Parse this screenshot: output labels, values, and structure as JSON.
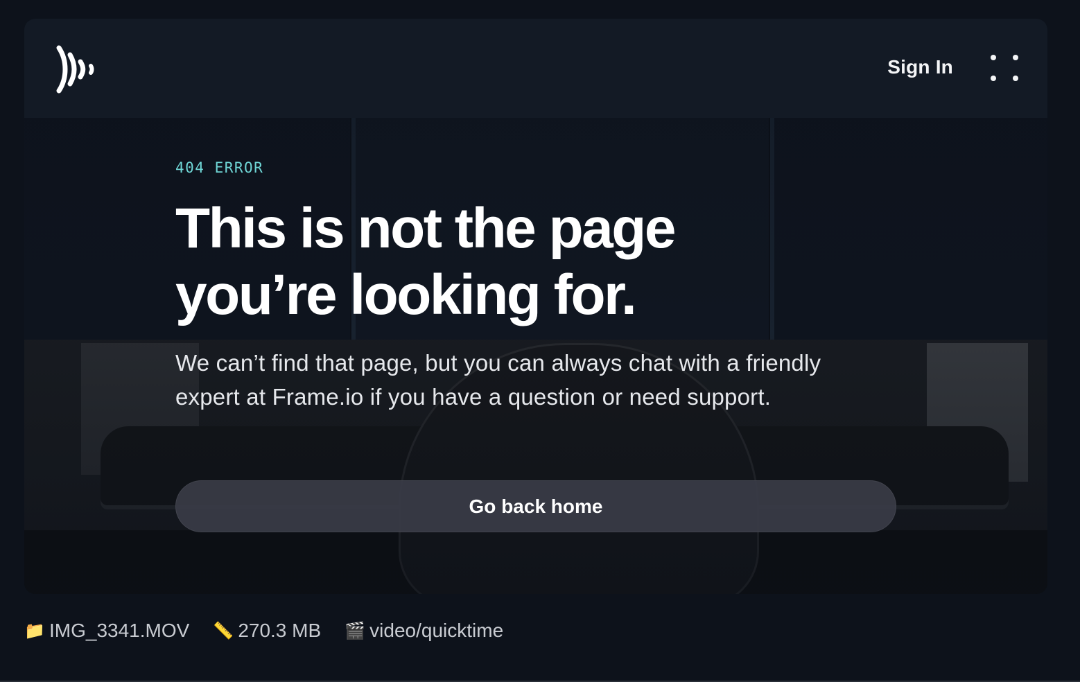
{
  "header": {
    "logo_icon": "frameio-logo-icon",
    "sign_in_label": "Sign In",
    "menu_icon": "grid-dots-icon"
  },
  "main": {
    "eyebrow": "404 ERROR",
    "title": "This is not the page you’re looking for.",
    "subtitle": "We can’t find that page, but you can always chat with a friendly expert at Frame.io if you have a question or need support.",
    "home_button_label": "Go back home"
  },
  "file_info": {
    "filename": "IMG_3341.MOV",
    "filename_icon": "folder-icon",
    "size": "270.3 MB",
    "size_icon": "ruler-icon",
    "mime": "video/quicktime",
    "mime_icon": "clapperboard-icon"
  },
  "colors": {
    "accent": "#6fd5d5",
    "background": "#0d121b",
    "button": "#3a3c46"
  }
}
